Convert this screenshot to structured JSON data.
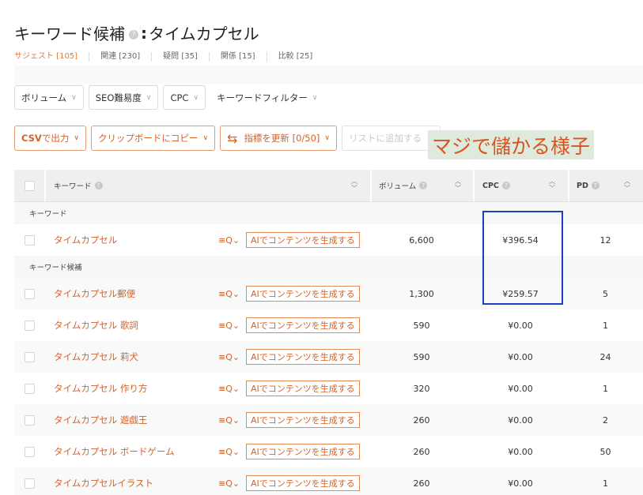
{
  "header": {
    "title_prefix": "キーワード候補",
    "help_icon": "question-icon",
    "colon": ":",
    "title_keyword": "タイムカプセル"
  },
  "tabs": [
    {
      "label": "サジェスト [105]",
      "active": true
    },
    {
      "label": "関連 [230]",
      "active": false
    },
    {
      "label": "疑問 [35]",
      "active": false
    },
    {
      "label": "関係 [15]",
      "active": false
    },
    {
      "label": "比較 [25]",
      "active": false
    }
  ],
  "filters": {
    "volume": "ボリューム",
    "seo": "SEO難易度",
    "cpc": "CPC",
    "keyword_filter": "キーワードフィルター"
  },
  "actions": {
    "csv_bold": "CSV",
    "csv_rest": "で出力",
    "clipboard": "クリップボードにコピー",
    "update": "指標を更新 [0/50]",
    "add_list": "リストに追加する"
  },
  "overlay_text": "マジで儲かる様子",
  "table": {
    "columns": {
      "keyword": "キーワード",
      "volume": "ボリューム",
      "cpc": "CPC",
      "pd": "PD"
    },
    "section_keyword": "キーワード",
    "section_candidates": "キーワード候補",
    "ai_label": "AIでコンテンツを生成する",
    "search_icon": "≡Q⌄",
    "main_row": {
      "keyword": "タイムカプセル",
      "volume": "6,600",
      "cpc": "¥396.54",
      "pd": "12"
    },
    "rows": [
      {
        "keyword": "タイムカプセル郵便",
        "volume": "1,300",
        "cpc": "¥259.57",
        "pd": "5"
      },
      {
        "keyword": "タイムカプセル 歌詞",
        "volume": "590",
        "cpc": "¥0.00",
        "pd": "1"
      },
      {
        "keyword": "タイムカプセル 莉犬",
        "volume": "590",
        "cpc": "¥0.00",
        "pd": "24"
      },
      {
        "keyword": "タイムカプセル 作り方",
        "volume": "320",
        "cpc": "¥0.00",
        "pd": "1"
      },
      {
        "keyword": "タイムカプセル 遊戯王",
        "volume": "260",
        "cpc": "¥0.00",
        "pd": "2"
      },
      {
        "keyword": "タイムカプセル ボードゲーム",
        "volume": "260",
        "cpc": "¥0.00",
        "pd": "50"
      },
      {
        "keyword": "タイムカプセルイラスト",
        "volume": "260",
        "cpc": "¥0.00",
        "pd": "1"
      }
    ]
  },
  "colors": {
    "accent": "#d4622a",
    "highlight": "#1d3fbf"
  }
}
